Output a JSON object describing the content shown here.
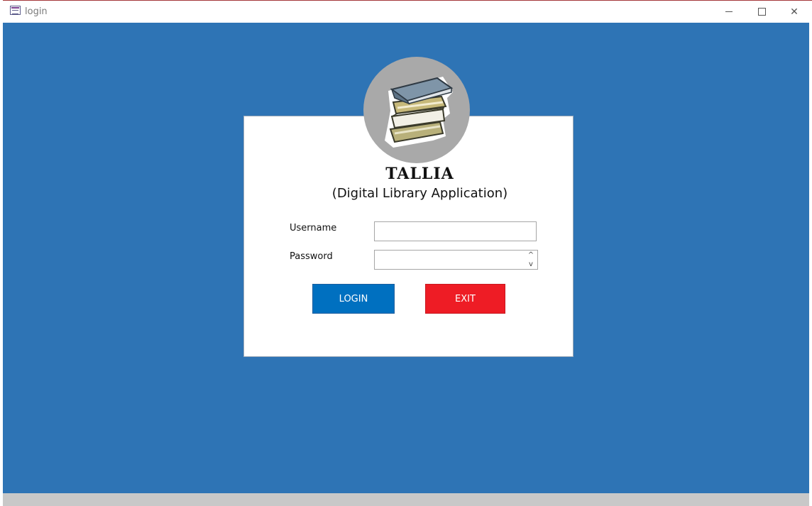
{
  "window": {
    "title": "login",
    "controls": {
      "minimize_icon": "minimize-icon",
      "maximize_icon": "maximize-icon",
      "close_icon": "close-icon",
      "close_glyph": "✕"
    }
  },
  "colors": {
    "background": "#2e74b5",
    "card": "#ffffff",
    "logo_circle": "#a9a9a9",
    "login_button": "#0070c0",
    "exit_button": "#ee1c25",
    "statusbar": "#c8c8c8"
  },
  "app": {
    "logo_icon": "books-stack-icon",
    "title": "TALLIA",
    "subtitle": "(Digital Library Application)"
  },
  "form": {
    "username_label": "Username",
    "username_value": "",
    "password_label": "Password",
    "password_value": "",
    "spinner_up": "^",
    "spinner_down": "v"
  },
  "buttons": {
    "login_label": "LOGIN",
    "exit_label": "EXIT"
  }
}
